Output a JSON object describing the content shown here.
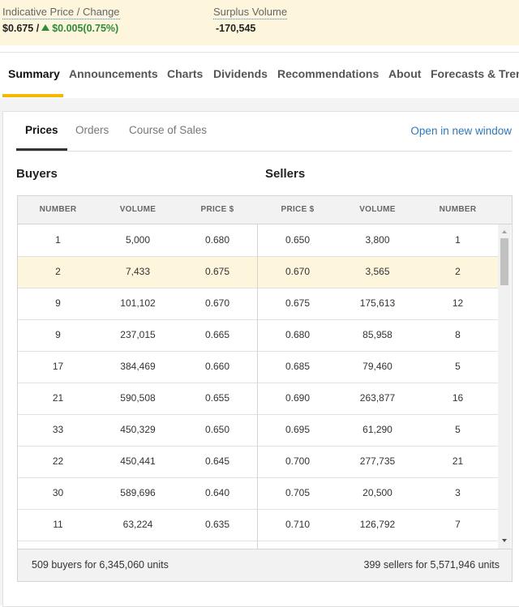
{
  "info": {
    "price_label": "Indicative Price / Change",
    "price_value": "$0.675 /",
    "change_value": "$0.005(0.75%)",
    "change_icon": "triangle-up-icon",
    "change_color": "#2e8b3a",
    "surplus_label": "Surplus Volume",
    "surplus_value": "-170,545"
  },
  "nav": {
    "tabs": [
      "Summary",
      "Announcements",
      "Charts",
      "Dividends",
      "Recommendations",
      "About",
      "Forecasts & Trends"
    ],
    "active": "Summary",
    "accent": "#f5b700"
  },
  "subnav": {
    "tabs": [
      "Prices",
      "Orders",
      "Course of Sales"
    ],
    "active": "Prices",
    "open_link": "Open in new window",
    "link_color": "#2f77b5"
  },
  "depth": {
    "buyers_title": "Buyers",
    "sellers_title": "Sellers",
    "headers": [
      "NUMBER",
      "VOLUME",
      "PRICE $",
      "PRICE $",
      "VOLUME",
      "NUMBER"
    ],
    "rows": [
      [
        "1",
        "5,000",
        "0.680",
        "0.650",
        "3,800",
        "1"
      ],
      [
        "2",
        "7,433",
        "0.675",
        "0.670",
        "3,565",
        "2"
      ],
      [
        "9",
        "101,102",
        "0.670",
        "0.675",
        "175,613",
        "12"
      ],
      [
        "9",
        "237,015",
        "0.665",
        "0.680",
        "85,958",
        "8"
      ],
      [
        "17",
        "384,469",
        "0.660",
        "0.685",
        "79,460",
        "5"
      ],
      [
        "21",
        "590,508",
        "0.655",
        "0.690",
        "263,877",
        "16"
      ],
      [
        "33",
        "450,329",
        "0.650",
        "0.695",
        "61,290",
        "5"
      ],
      [
        "22",
        "450,441",
        "0.645",
        "0.700",
        "277,735",
        "21"
      ],
      [
        "30",
        "589,696",
        "0.640",
        "0.705",
        "20,500",
        "3"
      ],
      [
        "11",
        "63,224",
        "0.635",
        "0.710",
        "126,792",
        "7"
      ]
    ],
    "highlight_row": 1,
    "highlight_color": "#fdf6dc",
    "buyers_summary": "509 buyers for 6,345,060 units",
    "sellers_summary": "399 sellers for 5,571,946 units"
  }
}
